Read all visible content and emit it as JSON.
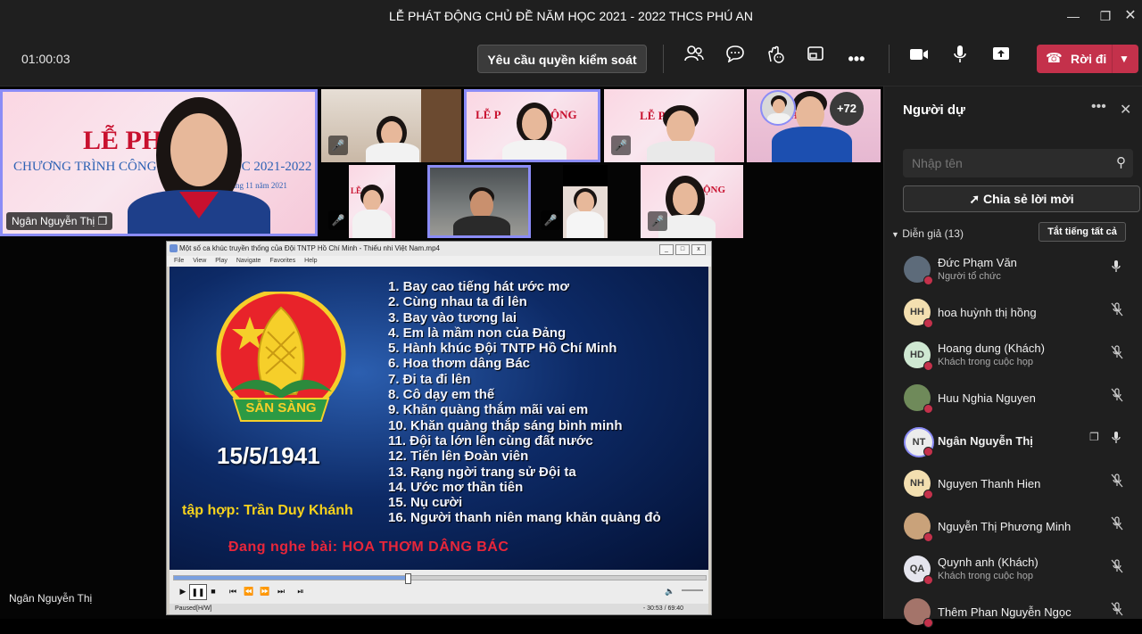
{
  "window": {
    "title": "LỄ PHÁT ĐỘNG CHỦ ĐỀ NĂM HỌC 2021 - 2022 THCS PHÚ AN"
  },
  "toolbar": {
    "timer": "01:00:03",
    "request_control": "Yêu cầu quyền kiểm soát",
    "leave_label": "Rời đi"
  },
  "stage": {
    "main_tile_name": "Ngân Nguyễn Thị",
    "banner": {
      "headline": "LỄ PHÁ",
      "subline": "CHƯƠNG TRÌNH CÔNG",
      "subline2": "HỌC 2021-2022",
      "date_fragment": "tháng 11 năm 2021"
    },
    "overflow_count": "+72",
    "bottom_name": "Ngân Nguyễn Thị"
  },
  "player": {
    "window_title": "Một số ca khúc truyền thống của Đội TNTP Hồ Chí Minh - Thiếu nhi Việt Nam.mp4",
    "menu": [
      "File",
      "View",
      "Play",
      "Navigate",
      "Favorites",
      "Help"
    ],
    "songs": [
      "1. Bay cao tiếng hát ước mơ",
      "2. Cùng nhau ta đi lên",
      "3. Bay vào tương lai",
      "4. Em là mầm non của Đảng",
      "5. Hành khúc Đội TNTP Hồ Chí Minh",
      "6. Hoa thơm dâng Bác",
      "7. Đi ta đi lên",
      "8. Cô dạy em thế",
      "9. Khăn quàng thắm mãi vai em",
      "10. Khăn quàng thắp sáng bình minh",
      "11. Đội ta lớn lên cùng đất nước",
      "12. Tiến lên Đoàn viên",
      "13. Rạng ngời trang sử Đội ta",
      "14. Ước mơ thần tiên",
      "15. Nụ cười",
      "16. Người thanh niên mang khăn quàng đỏ"
    ],
    "emblem_text": "SẴN SÀNG",
    "date": "15/5/1941",
    "composer": "tập hợp: Trần Duy Khánh",
    "now_playing": "Đang nghe bài: HOA THƠM DÂNG BÁC",
    "status_left": "Paused",
    "status_mode": "[H/W]",
    "status_time": "- 30:53 / 69:40",
    "progress": 0.44
  },
  "panel": {
    "title": "Người dự",
    "search_placeholder": "Nhập tên",
    "invite_label": "Chia sẻ lời mời",
    "section_label": "Diễn giả (13)",
    "mute_all": "Tắt tiếng tất cả",
    "participants": [
      {
        "initials": "",
        "name": "Đức Phạm Văn",
        "sub": "Người tổ chức",
        "mic": "on",
        "avatar_color": "#5d6b7a"
      },
      {
        "initials": "HH",
        "name": "hoa huỳnh thị hồng",
        "sub": "",
        "mic": "off",
        "avatar_color": "#f3dfb0"
      },
      {
        "initials": "HD",
        "name": "Hoang dung (Khách)",
        "sub": "Khách trong cuộc họp",
        "mic": "off",
        "avatar_color": "#cfe8d2"
      },
      {
        "initials": "",
        "name": "Huu Nghia Nguyen",
        "sub": "",
        "mic": "off",
        "avatar_color": "#6f8a5a"
      },
      {
        "initials": "NT",
        "name": "Ngân Nguyễn Thị",
        "sub": "",
        "mic": "on",
        "avatar_color": "#ececec",
        "sharing": true
      },
      {
        "initials": "NH",
        "name": "Nguyen Thanh Hien",
        "sub": "",
        "mic": "off",
        "avatar_color": "#f3dfb0"
      },
      {
        "initials": "",
        "name": "Nguyễn Thị Phương Minh",
        "sub": "",
        "mic": "off",
        "avatar_color": "#c9a27a"
      },
      {
        "initials": "QA",
        "name": "Quynh anh (Khách)",
        "sub": "Khách trong cuộc họp",
        "mic": "off",
        "avatar_color": "#e5e5ee"
      },
      {
        "initials": "",
        "name": "Thêm Phan Nguyễn Ngọc",
        "sub": "",
        "mic": "off",
        "avatar_color": "#a4746a"
      }
    ]
  }
}
